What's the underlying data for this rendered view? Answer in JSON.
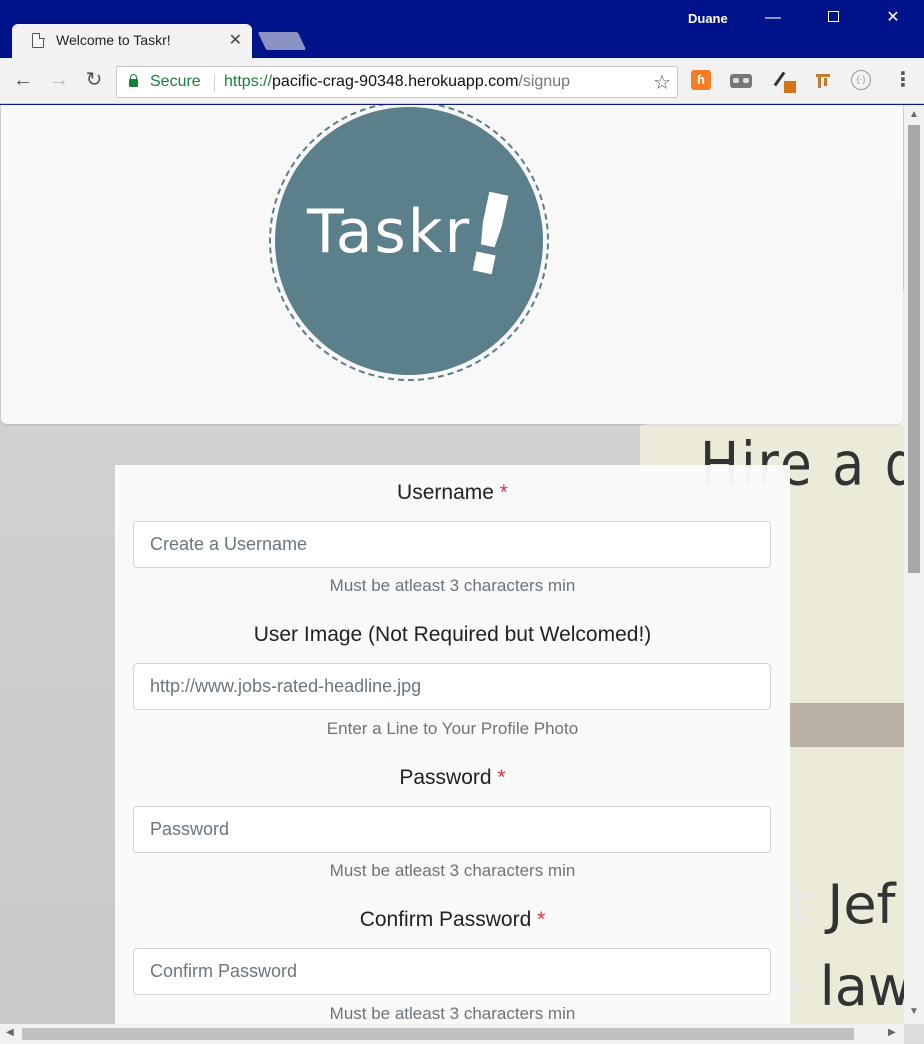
{
  "window": {
    "user": "Duane",
    "minimize_glyph": "—",
    "close_glyph": "✕"
  },
  "tab": {
    "title": "Welcome to Taskr!",
    "close_glyph": "✕"
  },
  "toolbar": {
    "back_glyph": "←",
    "forward_glyph": "→",
    "reload_glyph": "↻",
    "secure_label": "Secure",
    "url_scheme": "https://",
    "url_host": "pacific-crag-90348.herokuapp.com",
    "url_path": "/signup",
    "star_glyph": "☆",
    "menu_glyph": "⋮",
    "extension_1_glyph": "ɦ",
    "extension_5_glyph": "{·}",
    "extensions": [
      "h-extension-icon",
      "glasses-extension-icon",
      "color-picker-extension-icon",
      "ruler-extension-icon",
      "braces-extension-icon"
    ]
  },
  "logo": {
    "text": "Taskr",
    "exclaim": "!",
    "color": "#5b7f8b"
  },
  "background": {
    "note_line_1": "Hire a d",
    "note_line_2_faded": "Get ",
    "note_line_2": "Jef",
    "note_line_3_faded": "the ",
    "note_line_3": "law"
  },
  "form": {
    "required_marker": "*",
    "username": {
      "label": "Username",
      "placeholder": "Create a Username",
      "help": "Must be atleast 3 characters min"
    },
    "user_image": {
      "label": "User Image (Not Required but Welcomed!)",
      "placeholder": "http://www.jobs-rated-headline.jpg",
      "help": "Enter a Line to Your Profile Photo"
    },
    "password": {
      "label": "Password",
      "placeholder": "Password",
      "help": "Must be atleast 3 characters min"
    },
    "confirm_password": {
      "label": "Confirm Password",
      "placeholder": "Confirm Password",
      "help": "Must be atleast 3 characters min"
    }
  },
  "scrollbars": {
    "up_glyph": "▲",
    "down_glyph": "▼",
    "left_glyph": "◀",
    "right_glyph": "▶"
  },
  "colors": {
    "titlebar": "#00138a",
    "secure_green": "#188038",
    "required_red": "#dc3545"
  }
}
